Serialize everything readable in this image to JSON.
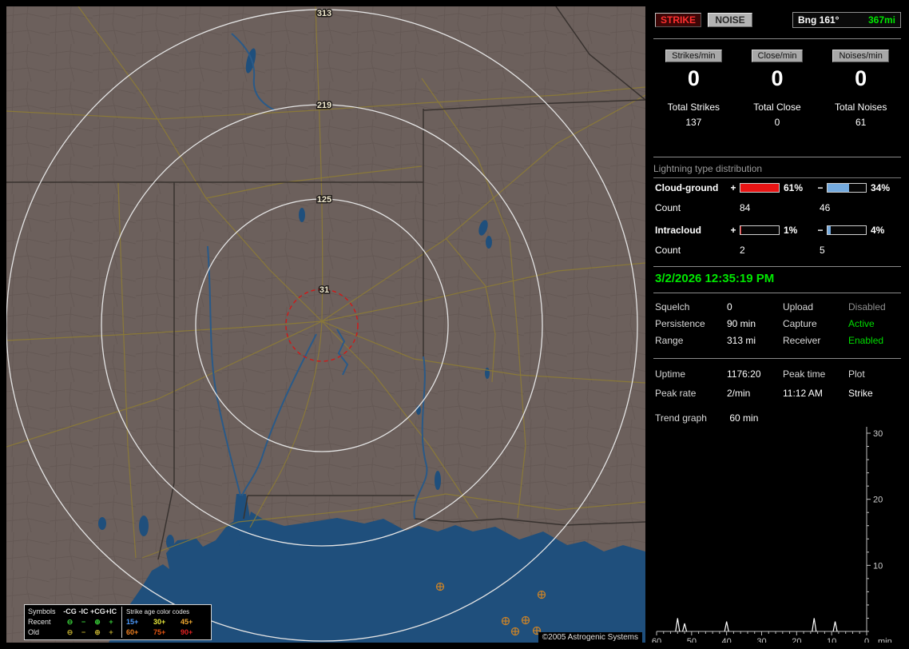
{
  "map": {
    "ring_labels": {
      "r1": "313",
      "r2": "219",
      "r3": "125",
      "r4": "31"
    },
    "strike_symbols": [
      [
        543,
        726
      ],
      [
        670,
        736
      ],
      [
        625,
        769
      ],
      [
        650,
        768
      ],
      [
        637,
        782
      ],
      [
        664,
        781
      ]
    ],
    "legend": {
      "symbols_header": "Symbols",
      "columns": [
        "-CG",
        "-IC",
        "+CG",
        "+IC"
      ],
      "age_header": "Strike age color codes",
      "recent_label": "Recent",
      "old_label": "Old",
      "recent_symbols": [
        "⊖",
        "−",
        "⊕",
        "+"
      ],
      "old_symbols": [
        "⊖",
        "−",
        "⊕",
        "+"
      ],
      "recent_ages": [
        {
          "text": "15+",
          "color": "#4e9cff"
        },
        {
          "text": "30+",
          "color": "#e8e83a"
        },
        {
          "text": "45+",
          "color": "#f0a830"
        }
      ],
      "old_ages": [
        {
          "text": "60+",
          "color": "#f08020"
        },
        {
          "text": "75+",
          "color": "#e85510"
        },
        {
          "text": "90+",
          "color": "#e02020"
        }
      ]
    },
    "copyright": "©2005 Astrogenic Systems"
  },
  "panel": {
    "strike_button": "STRIKE",
    "noise_button": "NOISE",
    "bearing_label": "Bng 161°",
    "bearing_distance": "367mi",
    "rate_counters": [
      {
        "label": "Strikes/min",
        "value": "0",
        "total_label": "Total Strikes",
        "total_value": "137"
      },
      {
        "label": "Close/min",
        "value": "0",
        "total_label": "Total Close",
        "total_value": "0"
      },
      {
        "label": "Noises/min",
        "value": "0",
        "total_label": "Total Noises",
        "total_value": "61"
      }
    ],
    "distribution": {
      "title": "Lightning type distribution",
      "plus_sign": "+",
      "minus_sign": "−",
      "rows": [
        {
          "label": "Cloud-ground",
          "plus_pct": "61%",
          "minus_pct": "34%",
          "plus_fill": 1.0,
          "minus_fill": 0.56,
          "count_label": "Count",
          "plus_count": "84",
          "minus_count": "46"
        },
        {
          "label": "Intracloud",
          "plus_pct": "1%",
          "minus_pct": "4%",
          "plus_fill": 0.03,
          "minus_fill": 0.08,
          "count_label": "Count",
          "plus_count": "2",
          "minus_count": "5"
        }
      ]
    },
    "datetime": "3/2/2026 12:35:19 PM",
    "settings": {
      "rows": [
        {
          "l1": "Squelch",
          "v1": "0",
          "l2": "Upload",
          "v2": "Disabled",
          "v2_color": "#8f8f8f"
        },
        {
          "l1": "Persistence",
          "v1": "90 min",
          "l2": "Capture",
          "v2": "Active",
          "v2_color": "#00dd00"
        },
        {
          "l1": "Range",
          "v1": "313 mi",
          "l2": "Receiver",
          "v2": "Enabled",
          "v2_color": "#00dd00"
        }
      ]
    },
    "stats": {
      "uptime_label": "Uptime",
      "uptime_value": "1176:20",
      "peak_time_label": "Peak time",
      "peak_time_value": "11:12 AM",
      "plot_label": "Plot",
      "plot_value": "Strike",
      "peak_rate_label": "Peak rate",
      "peak_rate_value": "2/min",
      "trend_label": "Trend graph",
      "trend_value": "60 min"
    },
    "colors": {
      "accent_green": "#00e800",
      "strike_red": "#ff3030",
      "bar_plus_red": "#e81414",
      "bar_minus_blue": "#74aade"
    }
  },
  "chart_data": {
    "type": "line",
    "title": "Trend graph",
    "window_label": "60 min",
    "xlabel": "min",
    "x_ticks": [
      "60",
      "50",
      "40",
      "30",
      "20",
      "10",
      "0"
    ],
    "y_ticks": [
      "30",
      "20",
      "10"
    ],
    "ylim": [
      0,
      30
    ],
    "x_axis_minutes_ago": [
      60,
      0
    ],
    "legend_position": "none",
    "grid": false,
    "series": [
      {
        "name": "Strike rate (/min)",
        "points": [
          {
            "x": 54,
            "y": 2.0
          },
          {
            "x": 52,
            "y": 1.2
          },
          {
            "x": 40,
            "y": 1.5
          },
          {
            "x": 15,
            "y": 2.0
          },
          {
            "x": 9,
            "y": 1.5
          }
        ]
      }
    ]
  }
}
